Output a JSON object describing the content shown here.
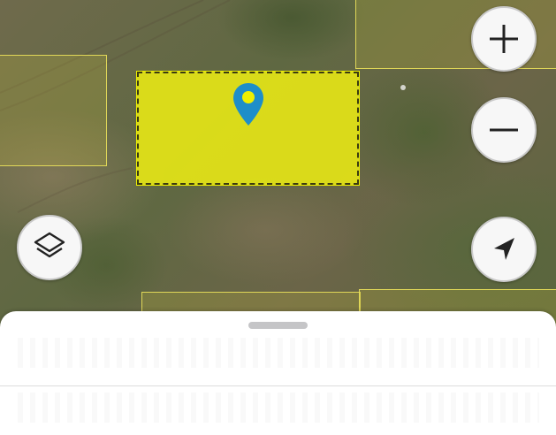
{
  "map": {
    "view": "satellite",
    "parcel_highlight_color": "#eef000",
    "parcel_outline_color": "#e6dc5a",
    "pin_color": "#1e8ec9"
  },
  "controls": {
    "zoom_in_icon": "plus-icon",
    "zoom_out_icon": "minus-icon",
    "layers_icon": "layers-icon",
    "locate_icon": "navigation-arrow-icon"
  },
  "sheet": {
    "ghost_title": "",
    "ghost_rows": 2
  }
}
